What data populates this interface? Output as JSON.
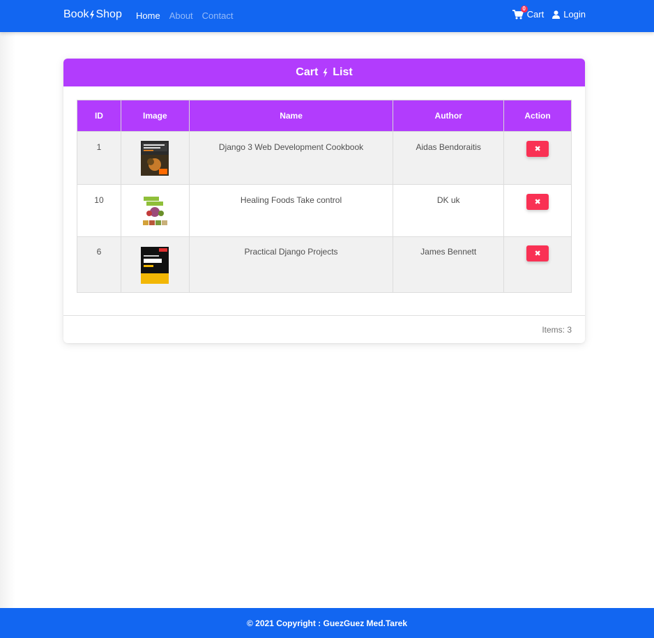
{
  "navbar": {
    "brand_left": "Book",
    "brand_right": "Shop",
    "links": [
      {
        "label": "Home",
        "active": true
      },
      {
        "label": "About",
        "active": false
      },
      {
        "label": "Contact",
        "active": false
      }
    ],
    "cart_label": "Cart",
    "cart_count": "0",
    "login_label": "Login",
    "icons": {
      "brand": "bolt-icon",
      "cart": "cart-icon",
      "login": "user-icon"
    }
  },
  "cart": {
    "title_left": "Cart",
    "title_right": "List",
    "columns": [
      "ID",
      "Image",
      "Name",
      "Author",
      "Action"
    ],
    "rows": [
      {
        "id": "1",
        "name": "Django 3 Web Development Cookbook",
        "author": "Aidas Bendoraitis",
        "action_icon": "times-icon"
      },
      {
        "id": "10",
        "name": "Healing Foods Take control",
        "author": "DK uk",
        "action_icon": "times-icon"
      },
      {
        "id": "6",
        "name": "Practical Django Projects",
        "author": "James Bennett",
        "action_icon": "times-icon"
      }
    ],
    "items_count_text": "Items: 3",
    "remove_symbol": "✖"
  },
  "footer": {
    "copyright": "© 2021 Copyright : GuezGuez Med.Tarek"
  },
  "colors": {
    "primary": "#1266f1",
    "accent": "#b23cfd",
    "danger": "#f93154"
  }
}
